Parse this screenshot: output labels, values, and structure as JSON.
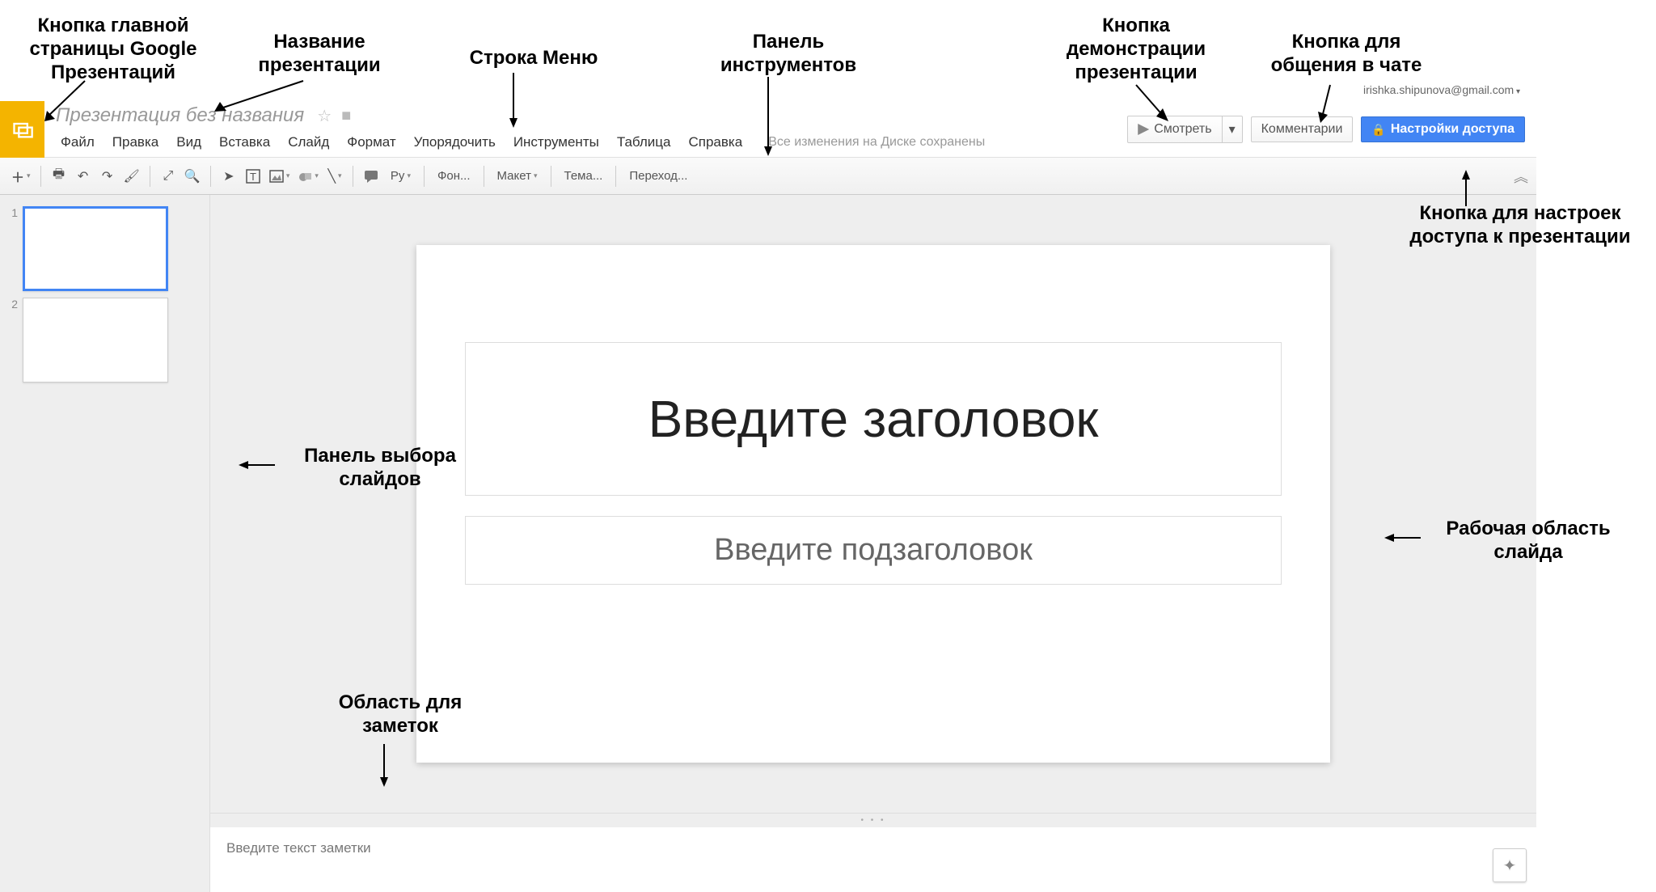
{
  "annotations": {
    "home_btn": "Кнопка главной страницы Google Презентаций",
    "title_label": "Название презентации",
    "menu_bar": "Строка Меню",
    "toolbar": "Панель инструментов",
    "present_btn": "Кнопка демонстрации презентации",
    "chat_btn": "Кнопка для общения в чате",
    "share_btn": "Кнопка для настроек доступа к презентации",
    "filmstrip": "Панель выбора слайдов",
    "workarea": "Рабочая область слайда",
    "notes_area": "Область для заметок"
  },
  "header": {
    "title": "Презентация без названия",
    "user_email": "irishka.shipunova@gmail.com",
    "save_status": "Все изменения на Диске сохранены"
  },
  "menu": {
    "file": "Файл",
    "edit": "Правка",
    "view": "Вид",
    "insert": "Вставка",
    "slide": "Слайд",
    "format": "Формат",
    "arrange": "Упорядочить",
    "tools": "Инструменты",
    "table": "Таблица",
    "help": "Справка"
  },
  "buttons": {
    "present": "Смотреть",
    "comments": "Комментарии",
    "share": "Настройки доступа"
  },
  "toolbar": {
    "font_label_prefix": "Ру",
    "background": "Фон...",
    "layout": "Макет",
    "theme": "Тема...",
    "transition": "Переход..."
  },
  "slides": {
    "n1": "1",
    "n2": "2"
  },
  "canvas": {
    "title_ph": "Введите заголовок",
    "sub_ph": "Введите подзаголовок"
  },
  "notes": {
    "placeholder": "Введите текст заметки"
  }
}
